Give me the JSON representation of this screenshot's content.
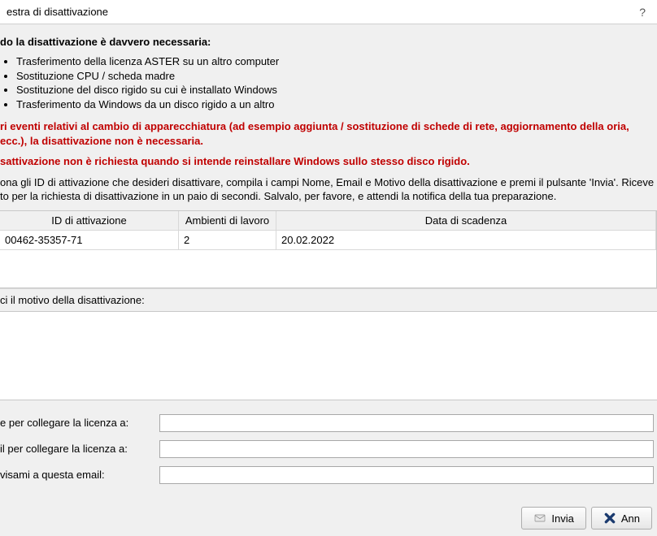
{
  "window": {
    "title": "estra di disattivazione",
    "help": "?"
  },
  "heading": "do la disattivazione è davvero necessaria:",
  "bullets": [
    "Trasferimento della licenza ASTER su un altro computer",
    "Sostituzione CPU / scheda madre",
    "Sostituzione del disco rigido su cui è installato Windows",
    "Trasferimento da Windows da un disco rigido a un altro"
  ],
  "warning1": "ri eventi relativi al cambio di apparecchiatura (ad esempio aggiunta / sostituzione di schede di rete, aggiornamento della oria, ecc.), la disattivazione non è necessaria.",
  "warning2": "sattivazione non è richiesta quando si intende reinstallare Windows sullo stesso disco rigido.",
  "instructions": "ona gli ID di attivazione che desideri disattivare, compila i campi Nome, Email e Motivo della disattivazione e premi il pulsante 'Invia'. Riceve to per la richiesta di disattivazione in un paio di secondi. Salvalo, per favore, e attendi la notifica della tua preparazione.",
  "table": {
    "headers": {
      "id": "ID di attivazione",
      "env": "Ambienti di lavoro",
      "exp": "Data di scadenza"
    },
    "rows": [
      {
        "id": "  00462-35357-71",
        "env": "2",
        "exp": "20.02.2022"
      }
    ]
  },
  "reason_label": "ci il motivo della disattivazione:",
  "reason_value": "",
  "form": {
    "name_label": "e per collegare la licenza a:",
    "name_value": "",
    "email_label": "il per collegare la licenza a:",
    "email_value": "",
    "notice_label": "visami a questa email:",
    "notice_value": ""
  },
  "buttons": {
    "send": "Invia",
    "cancel": "Ann"
  }
}
